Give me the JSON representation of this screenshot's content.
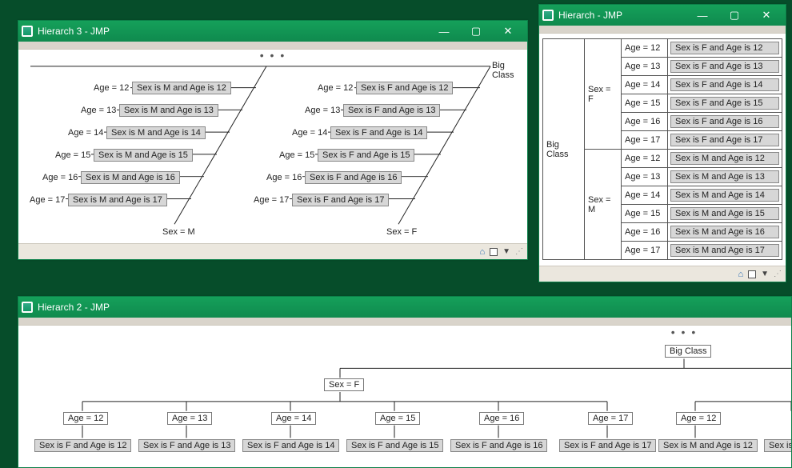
{
  "common": {
    "ellipsis": "• • •",
    "root_label": "Big Class"
  },
  "win3": {
    "title": "Hierarch 3 - JMP",
    "sex_m": "Sex = M",
    "sex_f": "Sex = F",
    "ages_m": [
      {
        "age": "Age = 12",
        "leaf": "Sex is M and Age is 12"
      },
      {
        "age": "Age = 13",
        "leaf": "Sex is M and Age is 13"
      },
      {
        "age": "Age = 14",
        "leaf": "Sex is M and Age is 14"
      },
      {
        "age": "Age = 15",
        "leaf": "Sex is M and Age is 15"
      },
      {
        "age": "Age = 16",
        "leaf": "Sex is M and Age is 16"
      },
      {
        "age": "Age = 17",
        "leaf": "Sex is M and Age is 17"
      }
    ],
    "ages_f": [
      {
        "age": "Age = 12",
        "leaf": "Sex is F and Age is 12"
      },
      {
        "age": "Age = 13",
        "leaf": "Sex is F and Age is 13"
      },
      {
        "age": "Age = 14",
        "leaf": "Sex is F and Age is 14"
      },
      {
        "age": "Age = 15",
        "leaf": "Sex is F and Age is 15"
      },
      {
        "age": "Age = 16",
        "leaf": "Sex is F and Age is 16"
      },
      {
        "age": "Age = 17",
        "leaf": "Sex is F and Age is 17"
      }
    ]
  },
  "win1": {
    "title": "Hierarch - JMP",
    "sex_f": "Sex = F",
    "sex_m": "Sex = M",
    "rows_f": [
      {
        "age": "Age = 12",
        "leaf": "Sex is F and Age is 12"
      },
      {
        "age": "Age = 13",
        "leaf": "Sex is F and Age is 13"
      },
      {
        "age": "Age = 14",
        "leaf": "Sex is F and Age is 14"
      },
      {
        "age": "Age = 15",
        "leaf": "Sex is F and Age is 15"
      },
      {
        "age": "Age = 16",
        "leaf": "Sex is F and Age is 16"
      },
      {
        "age": "Age = 17",
        "leaf": "Sex is F and Age is 17"
      }
    ],
    "rows_m": [
      {
        "age": "Age = 12",
        "leaf": "Sex is M and Age is 12"
      },
      {
        "age": "Age = 13",
        "leaf": "Sex is M and Age is 13"
      },
      {
        "age": "Age = 14",
        "leaf": "Sex is M and Age is 14"
      },
      {
        "age": "Age = 15",
        "leaf": "Sex is M and Age is 15"
      },
      {
        "age": "Age = 16",
        "leaf": "Sex is M and Age is 16"
      },
      {
        "age": "Age = 17",
        "leaf": "Sex is M and Age is 17"
      }
    ]
  },
  "win2": {
    "title": "Hierarch 2 - JMP",
    "sex_f": "Sex = F",
    "ages": [
      {
        "age": "Age = 12",
        "leaf": "Sex is F and Age is 12"
      },
      {
        "age": "Age = 13",
        "leaf": "Sex is F and Age is 13"
      },
      {
        "age": "Age = 14",
        "leaf": "Sex is F and Age is 14"
      },
      {
        "age": "Age = 15",
        "leaf": "Sex is F and Age is 15"
      },
      {
        "age": "Age = 16",
        "leaf": "Sex is F and Age is 16"
      },
      {
        "age": "Age = 17",
        "leaf": "Sex is F and Age is 17"
      }
    ],
    "extra_age": "Age = 12",
    "extra_leaf": "Sex is M and Age is 12",
    "extra_leaf2": "Sex is"
  }
}
